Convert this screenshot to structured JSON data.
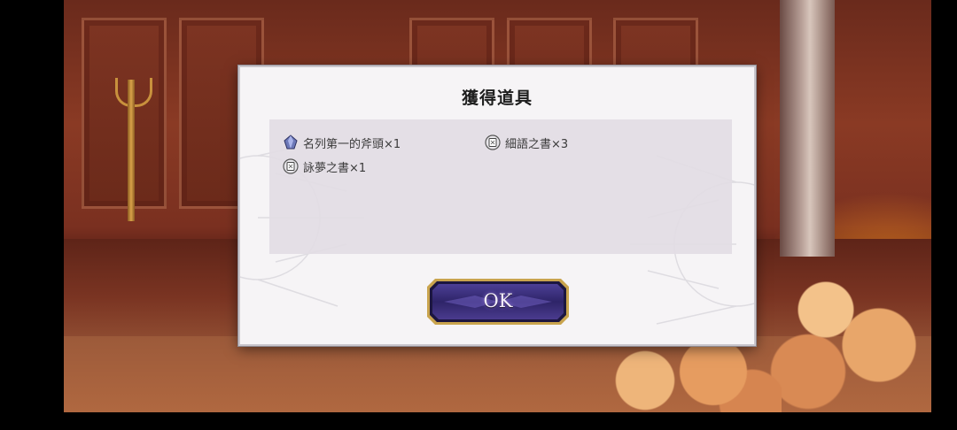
{
  "dialog": {
    "title": "獲得道具",
    "items": [
      {
        "icon": "crystal-icon",
        "label": "名列第一的斧頭×1"
      },
      {
        "icon": "book-icon",
        "label": "細語之書×3"
      },
      {
        "icon": "book-icon",
        "label": "詠夢之書×1"
      }
    ],
    "ok_label": "OK"
  },
  "colors": {
    "dialog_bg": "#f6f4f6",
    "panel_bg": "#e2dce4",
    "button_purple": "#3b2f7a",
    "button_gold": "#c9a44e"
  }
}
